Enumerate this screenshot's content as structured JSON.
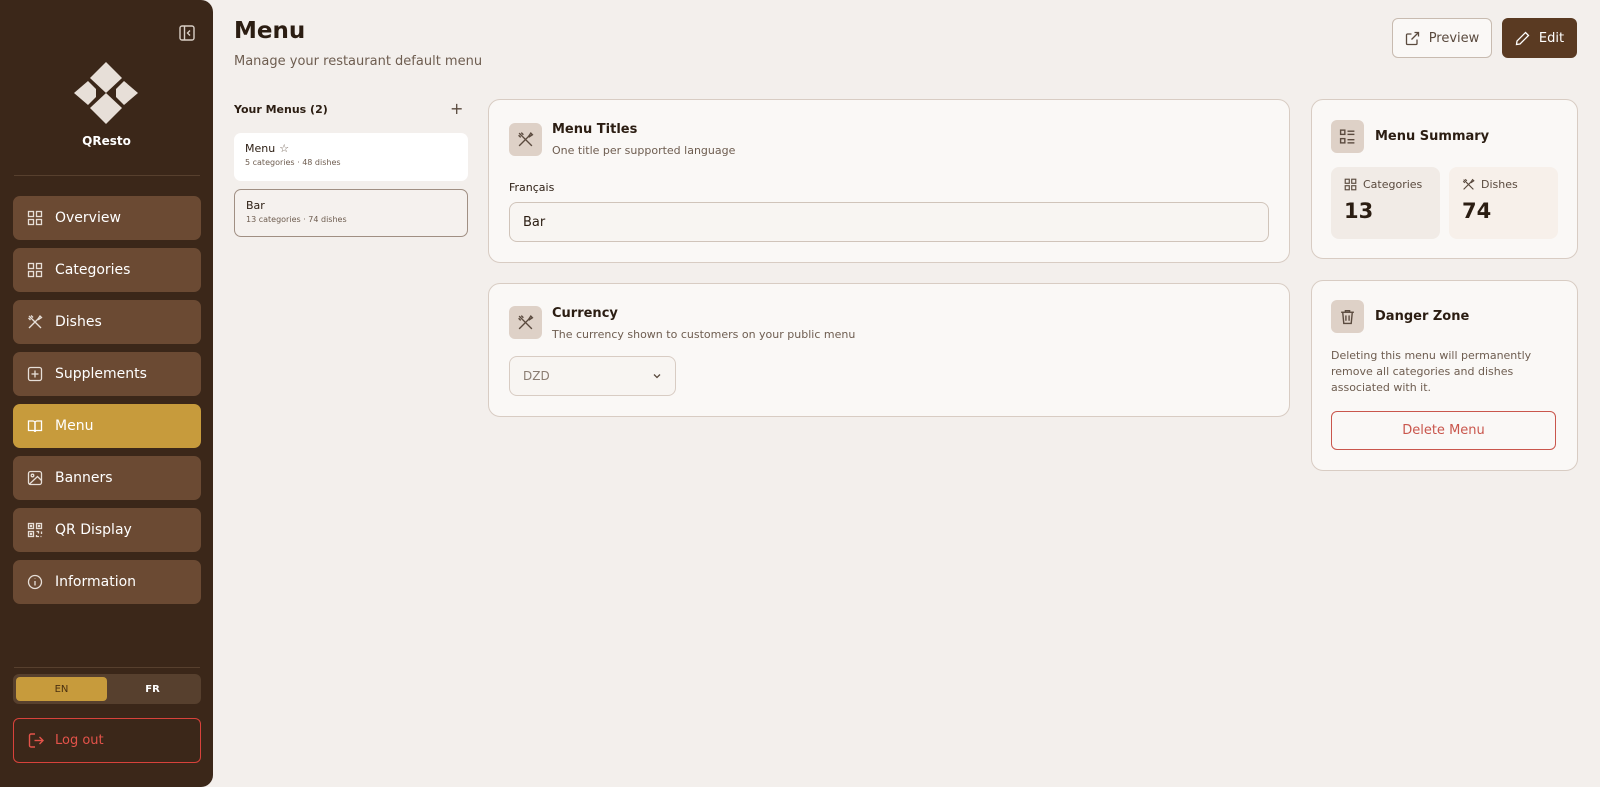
{
  "sidebar": {
    "brand": "QResto",
    "nav": [
      {
        "label": "Overview",
        "icon": "grid-icon"
      },
      {
        "label": "Categories",
        "icon": "grid-icon"
      },
      {
        "label": "Dishes",
        "icon": "utensils-icon"
      },
      {
        "label": "Supplements",
        "icon": "plus-square-icon"
      },
      {
        "label": "Menu",
        "icon": "book-open-icon",
        "active": true
      },
      {
        "label": "Banners",
        "icon": "image-icon"
      },
      {
        "label": "QR Display",
        "icon": "qr-code-icon"
      },
      {
        "label": "Information",
        "icon": "info-icon"
      }
    ],
    "languages": [
      "EN",
      "FR"
    ],
    "active_language": "EN",
    "logout_label": "Log out"
  },
  "header": {
    "title": "Menu",
    "subtitle": "Manage your restaurant default menu",
    "preview_label": "Preview",
    "edit_label": "Edit"
  },
  "menus": {
    "heading": "Your Menus (2)",
    "add_label": "+",
    "items": [
      {
        "name": "Menu",
        "star": "☆",
        "meta": "5 categories · 48 dishes"
      },
      {
        "name": "Bar",
        "meta": "13 categories · 74 dishes"
      }
    ]
  },
  "titles_card": {
    "title": "Menu Titles",
    "subtitle": "One title per supported language",
    "field_label": "Français",
    "field_value": "Bar"
  },
  "currency_card": {
    "title": "Currency",
    "subtitle": "The currency shown to customers on your public menu",
    "selected": "DZD"
  },
  "summary": {
    "title": "Menu Summary",
    "categories_label": "Categories",
    "categories_value": "13",
    "dishes_label": "Dishes",
    "dishes_value": "74"
  },
  "danger": {
    "title": "Danger Zone",
    "text": "Deleting this menu will permanently remove all categories and dishes associated with it.",
    "delete_label": "Delete Menu"
  },
  "colors": {
    "sidebar_bg": "#3b2719",
    "nav_item_bg": "#6b4a33",
    "accent": "#c79b3c",
    "primary_button": "#5a3a22",
    "danger": "#c9564c",
    "page_bg": "#f3efec"
  }
}
